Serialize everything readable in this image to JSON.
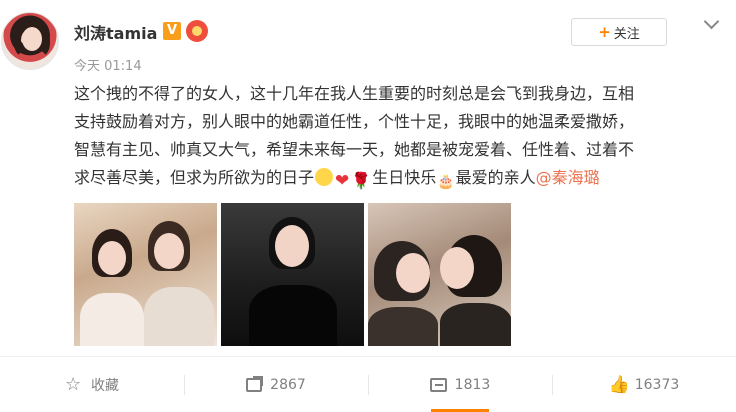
{
  "post": {
    "author": "刘涛tamia",
    "time": "今天 01:14",
    "follow_label": "关注",
    "content_lines": [
      "这个拽的不得了的女人，这十几年在我人生重要的时刻总是会飞到我身边，互相",
      "支持鼓励着对方，别人眼中的她霸道任性，个性十足，我眼中的她温柔爱撒娇，",
      "智慧有主见、帅真又大气，希望未来每一天，她都是被宠爱着、任性着、过着不",
      "求尽善尽美，但求为所欲为的日子"
    ],
    "content_tail": "生日快乐",
    "content_tail2": "最爱的亲人",
    "mention": "@秦海璐"
  },
  "actions": {
    "favorite_label": "收藏",
    "repost_count": "2867",
    "comment_count": "1813",
    "like_count": "16373"
  },
  "icons": {
    "vip": "V",
    "heart": "❤",
    "rose": "🌹",
    "cake": "🎂"
  },
  "colors": {
    "accent": "#ff8200",
    "mention": "#eb7350",
    "vip_badge": "#f89e1b"
  }
}
